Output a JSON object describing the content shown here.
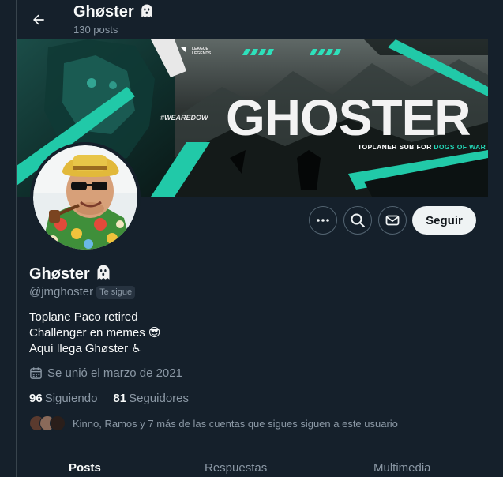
{
  "header": {
    "title": "Ghøster",
    "post_count": "130 posts"
  },
  "banner": {
    "title": "GHOSTER",
    "subtitle_prefix": "TOPLANER SUB FOR ",
    "subtitle_accent": "DOGS OF WAR",
    "hashtag": "#WEAREDOW",
    "logo_line1": "LEAGUE",
    "logo_line2": "LEGENDS"
  },
  "actions": {
    "more_icon": "more-dots-icon",
    "search_icon": "search-icon",
    "message_icon": "envelope-icon",
    "follow_label": "Seguir"
  },
  "profile": {
    "name": "Ghøster",
    "handle": "@jmghoster",
    "follows_you": "Te sigue",
    "bio": [
      "Toplane Paco retired",
      "Challenger en memes 😎",
      "Aquí llega Ghøster ♿"
    ],
    "joined": "Se unió el marzo de 2021",
    "following_count": "96",
    "following_label": "Siguiendo",
    "followers_count": "81",
    "followers_label": "Seguidores",
    "known_followers": "Kinno, Ramos y 7 más de las cuentas que sigues siguen a este usuario"
  },
  "tabs": [
    {
      "label": "Posts"
    },
    {
      "label": "Respuestas"
    },
    {
      "label": "Multimedia"
    }
  ],
  "colors": {
    "background": "#15202b",
    "accent": "#23d6b6",
    "secondary_text": "#8b98a5"
  }
}
